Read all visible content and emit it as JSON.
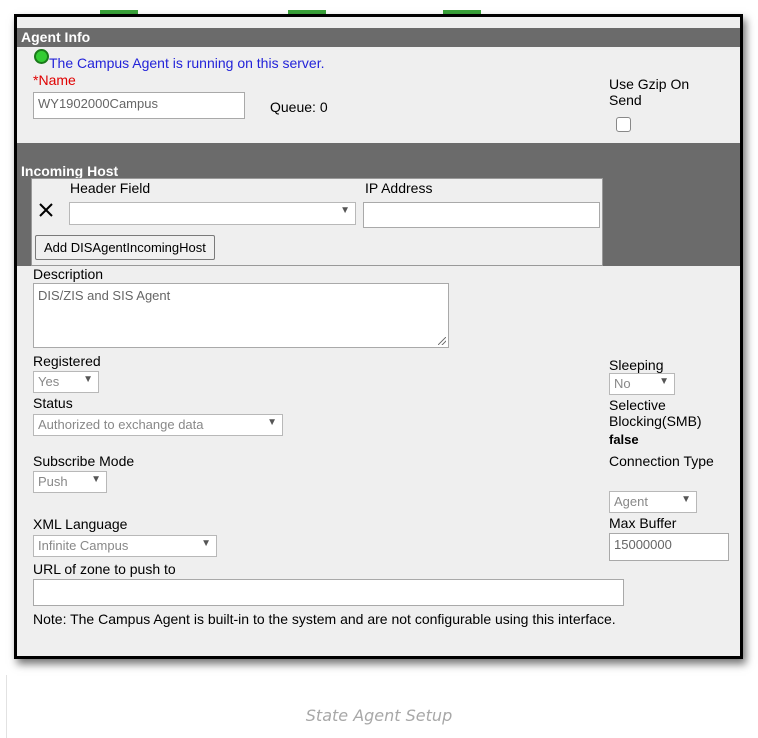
{
  "agent_info": {
    "header": "Agent Info",
    "status_message": "The Campus Agent is running on this server.",
    "required_marker": "*",
    "name_label": "Name",
    "name_value": "WY1902000Campus",
    "queue_text": "Queue: 0",
    "gzip_label": "Use Gzip On Send"
  },
  "incoming_host": {
    "header": "Incoming Host",
    "col_header_field": "Header Field",
    "col_ip_address": "IP Address",
    "header_field_value": "",
    "ip_address_value": "",
    "add_button": "Add DISAgentIncomingHost"
  },
  "description": {
    "label": "Description",
    "value": "DIS/ZIS and SIS Agent"
  },
  "registered": {
    "label": "Registered",
    "value": "Yes"
  },
  "status": {
    "label": "Status",
    "value": "Authorized to exchange data"
  },
  "subscribe_mode": {
    "label": "Subscribe Mode",
    "value": "Push"
  },
  "xml_language": {
    "label": "XML Language",
    "value": "Infinite Campus"
  },
  "url_zone": {
    "label": "URL of zone to push to",
    "value": ""
  },
  "sleeping": {
    "label": "Sleeping",
    "value": "No"
  },
  "selective_blocking": {
    "label": "Selective Blocking(SMB)",
    "value": "false"
  },
  "connection_type": {
    "label": "Connection Type",
    "value": "Agent"
  },
  "max_buffer": {
    "label": "Max Buffer",
    "value": "15000000"
  },
  "note": "Note: The Campus Agent is built-in to the system and are not configurable using this interface.",
  "caption": "State Agent Setup",
  "colors": {
    "header_bg": "#6b6b6b",
    "panel_bg": "#efefef",
    "status_text": "#2323d9",
    "required": "#e00000",
    "status_dot": "#33cc33",
    "tab_accent": "#3aa33a"
  },
  "icons": {
    "status": "green-circle-icon",
    "remove": "close-x-icon",
    "dropdown": "triangle-down-icon"
  }
}
